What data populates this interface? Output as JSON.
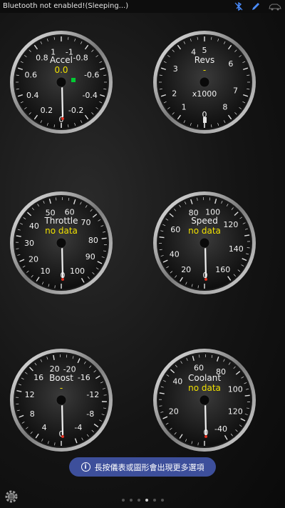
{
  "status_bar": {
    "message": "Bluetooth not enabled!(Sleeping...)",
    "icons": [
      "bluetooth-off-icon",
      "pencil-icon",
      "car-icon"
    ]
  },
  "gauges": [
    {
      "id": "accel",
      "label": "Accel",
      "value": "0.0",
      "ticks": [
        "1",
        "0.8",
        "0.6",
        "0.4",
        "0.2",
        "0",
        "-0.2",
        "-0.4",
        "-0.6",
        "-0.8",
        "-1"
      ],
      "status_light_color": "#00cc33",
      "value_color": "#f0e000"
    },
    {
      "id": "revs",
      "label": "Revs",
      "value": "-",
      "unit": "x1000",
      "ticks": [
        "0",
        "1",
        "2",
        "3",
        "4",
        "5",
        "6",
        "7",
        "8"
      ],
      "value_color": "#f0e000"
    },
    {
      "id": "throttle",
      "label": "Throttle",
      "value": "no data",
      "ticks": [
        "0",
        "10",
        "20",
        "30",
        "40",
        "50",
        "60",
        "70",
        "80",
        "90",
        "100"
      ],
      "value_color": "#f0e000"
    },
    {
      "id": "speed",
      "label": "Speed",
      "value": "no data",
      "ticks": [
        "0",
        "20",
        "40",
        "60",
        "80",
        "100",
        "120",
        "140",
        "160"
      ],
      "value_color": "#f0e000"
    },
    {
      "id": "boost",
      "label": "Boost",
      "value": "-",
      "ticks": [
        "0",
        "4",
        "8",
        "12",
        "16",
        "20",
        "-20",
        "-16",
        "-12",
        "-8",
        "-4"
      ],
      "value_color": "#f0e000"
    },
    {
      "id": "coolant",
      "label": "Coolant",
      "value": "no data",
      "ticks": [
        "-40",
        "120",
        "100",
        "80",
        "60",
        "40",
        "20",
        "0"
      ],
      "value_color": "#f0e000"
    }
  ],
  "toast": {
    "icon": "info-icon",
    "text": "長按儀表或圖形會出現更多選項"
  },
  "pager": {
    "count": 6,
    "active_index": 3
  },
  "settings": {
    "icon": "settings-icon"
  },
  "colors": {
    "toast_bg": "#3d4f9b",
    "needle": "#f2f2f2",
    "bezel": "#c8c8c8"
  }
}
